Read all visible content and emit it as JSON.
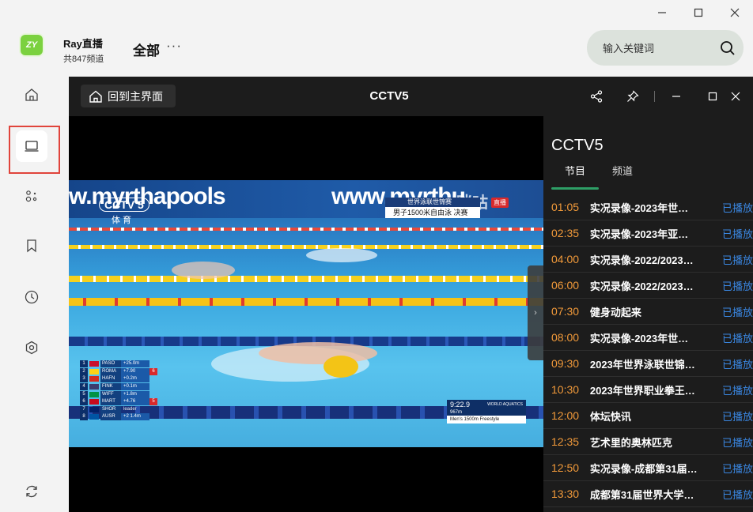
{
  "window": {
    "controls": [
      "minimize-icon",
      "maximize-icon",
      "close-icon"
    ]
  },
  "app": {
    "name": "Ray直播",
    "channel_count": "共847频道",
    "category": "全部",
    "more": "···",
    "search_placeholder": "输入关键词"
  },
  "sidebar": {
    "items": [
      {
        "icon": "home-icon"
      },
      {
        "icon": "tv-icon",
        "active": true
      },
      {
        "icon": "apps-icon"
      },
      {
        "icon": "bookmark-icon"
      },
      {
        "icon": "history-icon"
      },
      {
        "icon": "settings-icon"
      },
      {
        "icon": "refresh-icon"
      }
    ],
    "highlight_color": "#e0443b"
  },
  "player": {
    "home_label": "回到主界面",
    "title": "CCTV5",
    "tools": [
      "share-icon",
      "pin-icon",
      "minimize-icon",
      "maximize-icon",
      "close-icon"
    ]
  },
  "video": {
    "banner_left": "w.myrthapools",
    "banner_right": "www.myrthu",
    "watermark": "咪咕",
    "channel_logo": "CCTV 5",
    "channel_sub": "体 育",
    "event_line1": "世界泳联世锦赛",
    "event_line2": "男子1500米自由泳 决赛",
    "live_tag": "直播",
    "scoreboard": [
      {
        "n": "1",
        "name": "PASO",
        "value": "+25.0m",
        "rank": "",
        "extra": ""
      },
      {
        "n": "2",
        "name": "ROMA",
        "value": "+7.90",
        "rank": "6",
        "extra": ""
      },
      {
        "n": "3",
        "name": "HAFN",
        "value": "+0.2m",
        "rank": "",
        "extra": ""
      },
      {
        "n": "4",
        "name": "FINK",
        "value": "+0.1m",
        "rank": "",
        "extra": ""
      },
      {
        "n": "5",
        "name": "WIFF",
        "value": "+1.8m",
        "rank": "",
        "extra": ""
      },
      {
        "n": "6",
        "name": "MART",
        "value": "+4.76",
        "rank": "5",
        "extra": ""
      },
      {
        "n": "7",
        "name": "SHOR",
        "value": "",
        "rank": "",
        "extra": "leader"
      },
      {
        "n": "8",
        "name": "AUSR",
        "value": "+2 1.4m",
        "rank": "",
        "extra": ""
      }
    ],
    "timer_time": "9:22.9",
    "timer_brand": "WORLD AQUATICS",
    "timer_dist": "967m",
    "timer_event": "Men's 1500m Freestyle",
    "handle": "›"
  },
  "program": {
    "channel": "CCTV5",
    "tabs": [
      "节目",
      "频道"
    ],
    "items": [
      {
        "time": "01:05",
        "name": "实况录像-2023年世…",
        "status": "已播放"
      },
      {
        "time": "02:35",
        "name": "实况录像-2023年亚…",
        "status": "已播放"
      },
      {
        "time": "04:00",
        "name": "实况录像-2022/2023…",
        "status": "已播放"
      },
      {
        "time": "06:00",
        "name": "实况录像-2022/2023…",
        "status": "已播放"
      },
      {
        "time": "07:30",
        "name": "健身动起来",
        "status": "已播放"
      },
      {
        "time": "08:00",
        "name": "实况录像-2023年世…",
        "status": "已播放"
      },
      {
        "time": "09:30",
        "name": "2023年世界泳联世锦…",
        "status": "已播放"
      },
      {
        "time": "10:30",
        "name": "2023年世界职业拳王…",
        "status": "已播放"
      },
      {
        "time": "12:00",
        "name": "体坛快讯",
        "status": "已播放"
      },
      {
        "time": "12:35",
        "name": "艺术里的奥林匹克",
        "status": "已播放"
      },
      {
        "time": "12:50",
        "name": "实况录像-成都第31届…",
        "status": "已播放"
      },
      {
        "time": "13:30",
        "name": "成都第31届世界大学…",
        "status": "已播放"
      }
    ]
  }
}
